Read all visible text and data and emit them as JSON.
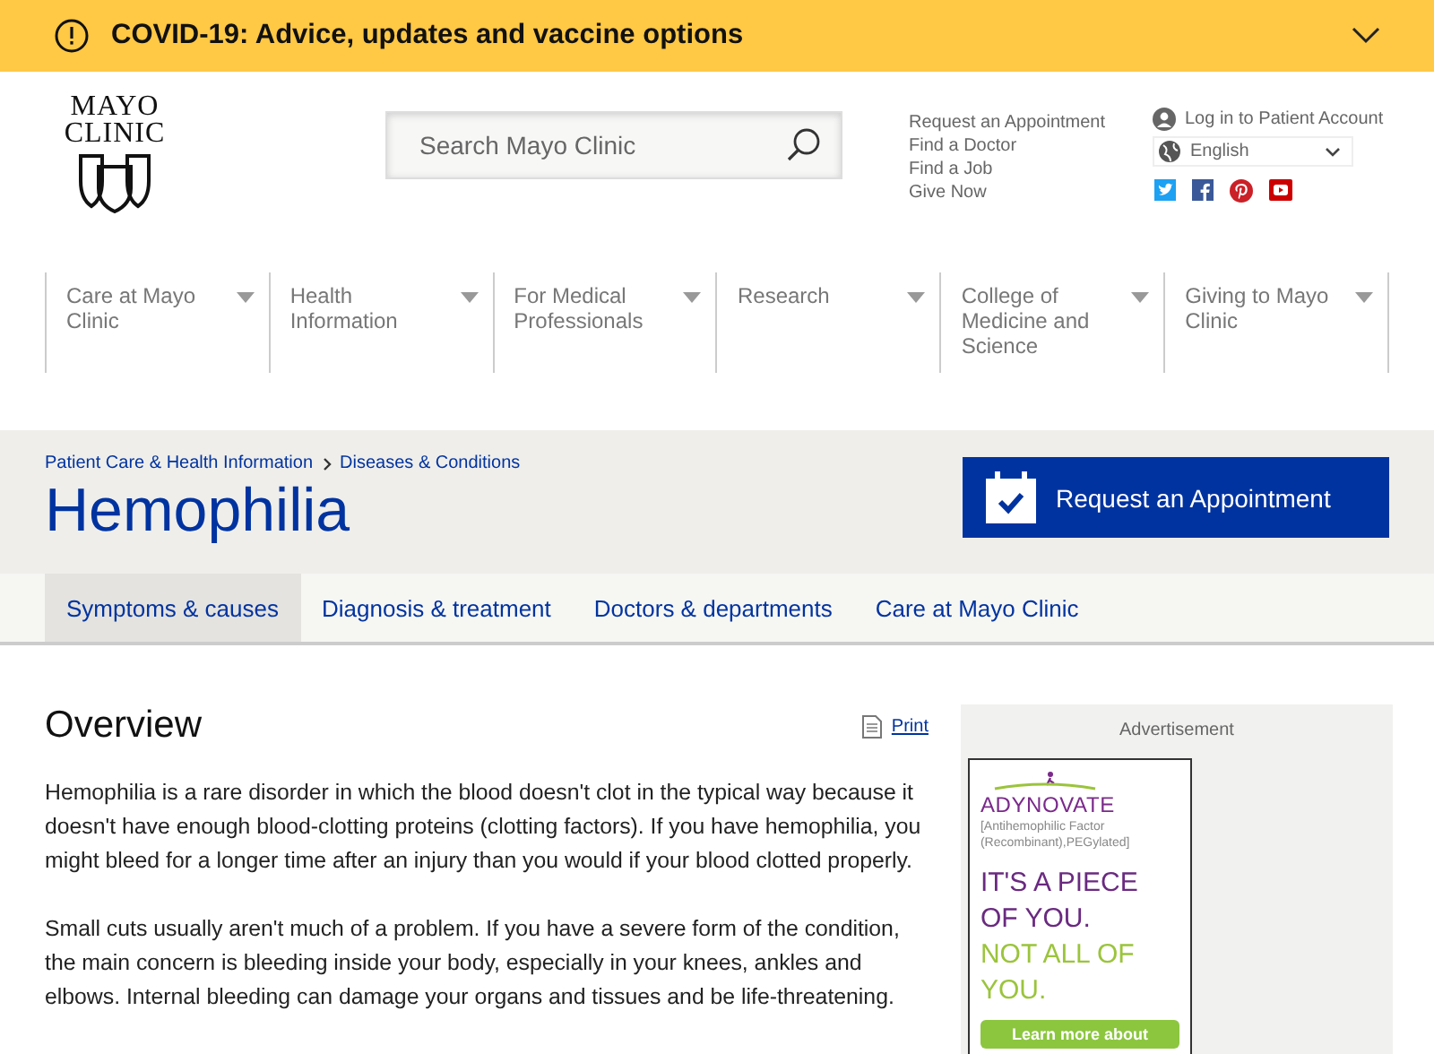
{
  "alert_banner": {
    "text": "COVID-19: Advice, updates and vaccine options"
  },
  "logo": {
    "lines": [
      "MAYO",
      "CLINIC"
    ]
  },
  "search": {
    "placeholder": "Search Mayo Clinic"
  },
  "utility_links": [
    "Request an Appointment",
    "Find a Doctor",
    "Find a Job",
    "Give Now"
  ],
  "account": {
    "login": "Log in to Patient Account",
    "language": "English"
  },
  "main_nav": [
    "Care at Mayo Clinic",
    "Health Information",
    "For Medical Professionals",
    "Research",
    "College of Medicine and Science",
    "Giving to Mayo Clinic"
  ],
  "breadcrumbs": [
    "Patient Care & Health Information",
    "Diseases & Conditions"
  ],
  "page_title": "Hemophilia",
  "appointment_button": "Request an Appointment",
  "tabs": [
    {
      "label": "Symptoms & causes",
      "selected": true
    },
    {
      "label": "Diagnosis & treatment",
      "selected": false
    },
    {
      "label": "Doctors & departments",
      "selected": false
    },
    {
      "label": "Care at Mayo Clinic",
      "selected": false
    }
  ],
  "section": {
    "heading": "Overview",
    "print": "Print",
    "paragraphs": [
      "Hemophilia is a rare disorder in which the blood doesn't clot in the typical way because it doesn't have enough blood-clotting proteins (clotting factors). If you have hemophilia, you might bleed for a longer time after an injury than you would if your blood clotted properly.",
      "Small cuts usually aren't much of a problem. If you have a severe form of the condition, the main concern is bleeding inside your body, especially in your knees, ankles and elbows. Internal bleeding can damage your organs and tissues and be life-threatening."
    ]
  },
  "advertisement": {
    "label": "Advertisement",
    "brand": "ADYNOVATE",
    "subtitle": "[Antihemophilic Factor (Recombinant),PEGylated]",
    "headline": "IT'S A PIECE OF YOU.",
    "headline_accent": "NOT ALL OF YOU.",
    "button": "Learn more about"
  }
}
